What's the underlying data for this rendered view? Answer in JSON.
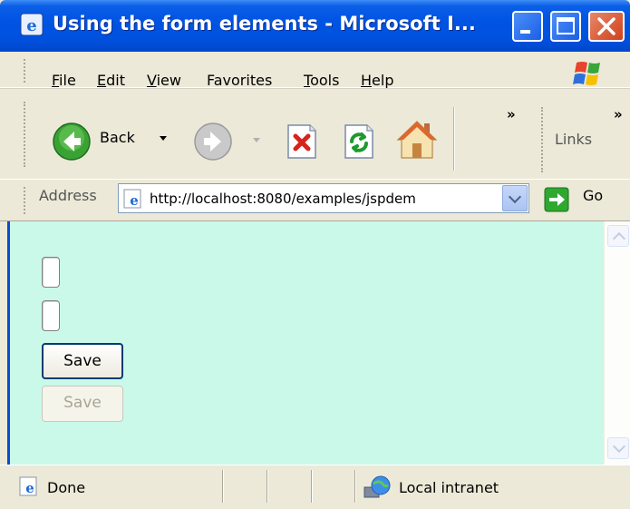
{
  "window": {
    "title": "Using the form elements - Microsoft I..."
  },
  "menu": {
    "items": [
      {
        "label_first": "F",
        "label_rest": "ile"
      },
      {
        "label_first": "E",
        "label_rest": "dit"
      },
      {
        "label_first": "V",
        "label_rest": "iew"
      },
      {
        "label_first": "Favorites"
      },
      {
        "label_first": "T",
        "label_rest": "ools"
      },
      {
        "label_first": "H",
        "label_rest": "elp"
      }
    ]
  },
  "toolbar": {
    "back_label": "Back",
    "links_label": "Links",
    "overflow_glyph": "»"
  },
  "address": {
    "label": "Address",
    "value": "http://localhost:8080/examples/jspdem",
    "go_label": "Go"
  },
  "page": {
    "background": "#caf9ea",
    "save_label": "Save",
    "save_disabled_label": "Save"
  },
  "status": {
    "text": "Done",
    "zone": "Local intranet"
  },
  "icons": {
    "title": "ie-icon",
    "back": "back-arrow-icon",
    "forward": "forward-arrow-icon",
    "stop": "stop-icon",
    "refresh": "refresh-icon",
    "home": "home-icon",
    "go": "go-arrow-icon",
    "status": "ie-page-icon",
    "zone": "intranet-globe-icon"
  },
  "colors": {
    "titlebar": "#0054e3",
    "close_button": "#d0421a",
    "chrome": "#ece9d8"
  }
}
